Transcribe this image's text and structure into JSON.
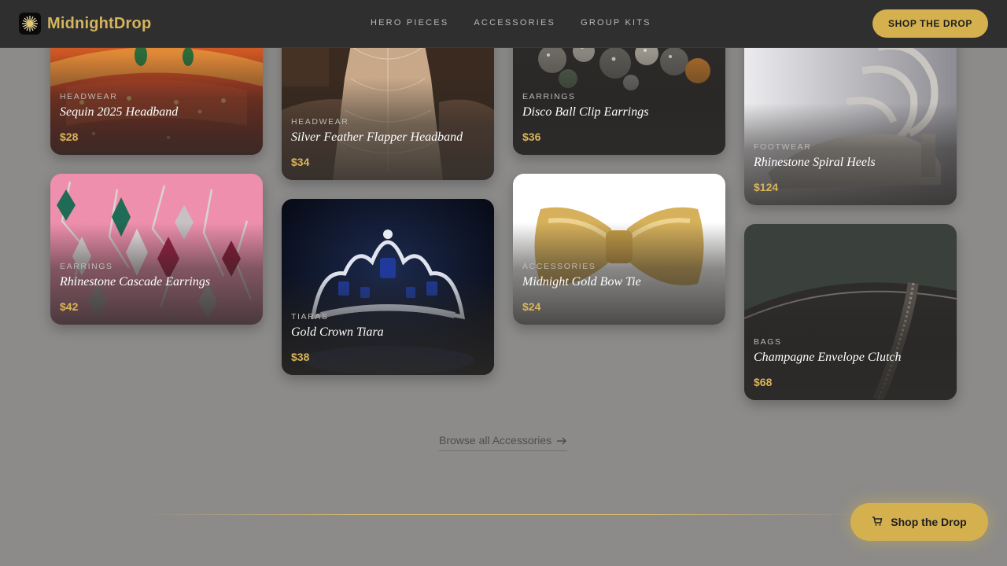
{
  "brand": {
    "name": "MidnightDrop"
  },
  "nav": {
    "items": [
      "HERO PIECES",
      "ACCESSORIES",
      "GROUP KITS"
    ]
  },
  "header": {
    "cta_label": "SHOP THE DROP"
  },
  "products": [
    {
      "category": "HEADWEAR",
      "name": "Sequin 2025 Headband",
      "price": "$28"
    },
    {
      "category": "HEADWEAR",
      "name": "Silver Feather Flapper Headband",
      "price": "$34"
    },
    {
      "category": "EARRINGS",
      "name": "Disco Ball Clip Earrings",
      "price": "$36"
    },
    {
      "category": "FOOTWEAR",
      "name": "Rhinestone Spiral Heels",
      "price": "$124"
    },
    {
      "category": "EARRINGS",
      "name": "Rhinestone Cascade Earrings",
      "price": "$42"
    },
    {
      "category": "TIARAS",
      "name": "Gold Crown Tiara",
      "price": "$38"
    },
    {
      "category": "ACCESSORIES",
      "name": "Midnight Gold Bow Tie",
      "price": "$24"
    },
    {
      "category": "BAGS",
      "name": "Champagne Envelope Clutch",
      "price": "$68"
    }
  ],
  "browse_link": {
    "label": "Browse all Accessories"
  },
  "floating_cta": {
    "label": "Shop the Drop"
  },
  "icons": {
    "logo": "starburst-icon",
    "arrow": "arrow-right-icon",
    "cart": "cart-icon"
  },
  "colors": {
    "accent": "#d4b04f",
    "header_bg": "#2f2f2f",
    "page_bg": "#8c8b8a",
    "price": "#d9b55a"
  }
}
